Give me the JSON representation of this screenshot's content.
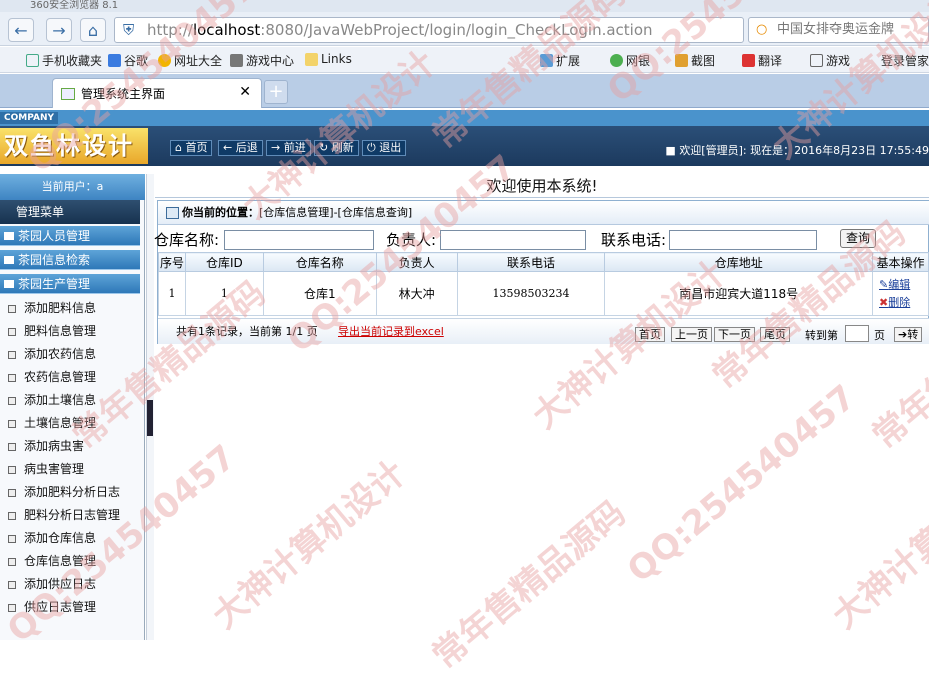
{
  "browser": {
    "title_partial": "360安全浏览器 8.1",
    "url_prefix": "http://",
    "url_host": "localhost",
    "url_rest": ":8080/JavaWebProject/login/login_CheckLogin.action",
    "search_text": "中国女排夺奥运金牌",
    "bookmarks": [
      "手机收藏夹",
      "谷歌",
      "网址大全",
      "游戏中心",
      "Links"
    ],
    "toolbar_right": [
      "扩展",
      "网银",
      "截图",
      "翻译",
      "游戏",
      "登录管家"
    ],
    "tab_title": "管理系统主界面",
    "new_tab_label": "+"
  },
  "app": {
    "company": "COMPANY",
    "logo": "双鱼林设计",
    "toolbar": [
      "首页",
      "后退",
      "前进",
      "刷新",
      "退出"
    ],
    "welcome": "欢迎[管理员]:   现在是：2016年8月23日 17:55:49",
    "current_user": "当前用户：a",
    "menu_title": "管理菜单",
    "groups": [
      "茶园人员管理",
      "茶园信息检索",
      "茶园生产管理"
    ],
    "menu_items": [
      "添加肥料信息",
      "肥料信息管理",
      "添加农药信息",
      "农药信息管理",
      "添加土壤信息",
      "土壤信息管理",
      "添加病虫害",
      "病虫害管理",
      "添加肥料分析日志",
      "肥料分析日志管理",
      "添加仓库信息",
      "仓库信息管理",
      "添加供应日志",
      "供应日志管理"
    ]
  },
  "main": {
    "welcome_title": "欢迎使用本系统!",
    "position_label": "你当前的位置：",
    "position_path": "[仓库信息管理]-[仓库信息查询]",
    "filters": {
      "name_label": "仓库名称:",
      "manager_label": "负责人:",
      "phone_label": "联系电话:",
      "query_button": "查询"
    },
    "table": {
      "headers": [
        "序号",
        "仓库ID",
        "仓库名称",
        "负责人",
        "联系电话",
        "仓库地址",
        "基本操作"
      ],
      "rows": [
        {
          "no": "1",
          "id": "1",
          "name": "仓库1",
          "manager": "林大冲",
          "phone": "13598503234",
          "address": "南昌市迎宾大道118号",
          "edit": "编辑",
          "delete": "删除"
        }
      ]
    },
    "pager": {
      "summary": "共有1条记录，当前第 1/1 页",
      "export": "导出当前记录到excel",
      "first": "首页",
      "prev": "上一页",
      "next": "下一页",
      "last": "尾页",
      "goto_label": "转到第",
      "page_unit": "页",
      "go": "转"
    }
  },
  "watermark": [
    "QQ:254540457",
    "大神计算机设计",
    "常年售精品源码"
  ]
}
